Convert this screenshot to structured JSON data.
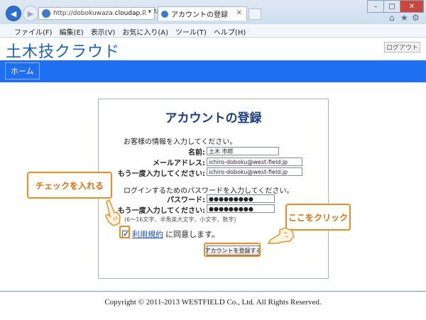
{
  "browser": {
    "url_prefix": "http://dobokuwaza.",
    "url_host": "cloudap...",
    "tab_label": "アカウントの登録",
    "address_tools": "ρ ▾ ↻"
  },
  "menu": [
    "ファイル(F)",
    "編集(E)",
    "表示(V)",
    "お気に入り(A)",
    "ツール(T)",
    "ヘルプ(H)"
  ],
  "site": {
    "logo": "土木技クラウド",
    "logout": "ログアウト",
    "nav_home": "ホーム"
  },
  "form": {
    "title": "アカウントの登録",
    "intro_customer": "お客様の情報を入力してください。",
    "name_label": "名前:",
    "name_value": "土木 市郎",
    "email_label": "メールアドレス:",
    "email_value": "ichiro-doboku@west-field.jp",
    "email2_label": "もう一度入力してください:",
    "email2_value": "ichiro-doboku@west-field.jp",
    "intro_password": "ログインするためのパスワードを入力してください。",
    "password_label": "パスワード:",
    "password_value": "●●●●●●●●●",
    "password2_label": "もう一度入力してください:",
    "password2_value": "●●●●●●●●●",
    "password_hint": "(6〜16文字、半角英大文字、小文字、数字)",
    "agree_checkbox": "✓",
    "terms_link": "利用規約",
    "agree_suffix": "に同意します。",
    "submit_label": "アカウントを登録する"
  },
  "annotations": {
    "check_callout": "チェックを入れる",
    "click_callout": "ここをクリック"
  },
  "footer": {
    "copyright": "Copyright © 2011-2013 WESTFIELD Co., Ltd. All Rights Reserved."
  }
}
